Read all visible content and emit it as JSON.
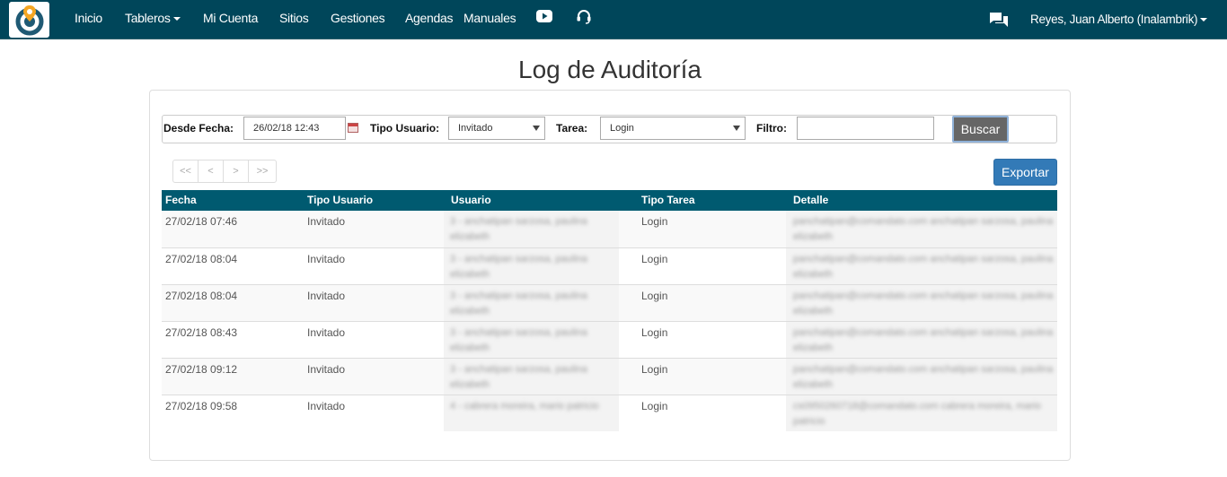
{
  "nav": {
    "items": [
      "Inicio",
      "Tableros",
      "Mi Cuenta",
      "Sitios",
      "Gestiones",
      "Agendas",
      "Manuales"
    ],
    "user": "Reyes, Juan Alberto (Inalambrik)",
    "colors": {
      "bar": "#00465a",
      "text": "#ffffff"
    },
    "icons": [
      "logo-icon",
      "youtube-icon",
      "headset-icon",
      "chat-icon"
    ]
  },
  "title": "Log de Auditoría",
  "filters": {
    "desde_label": "Desde Fecha:",
    "desde_value": "26/02/18 12:43",
    "tipo_label": "Tipo Usuario:",
    "tipo_value": "Invitado",
    "tarea_label": "Tarea:",
    "tarea_value": "Login",
    "filtro_label": "Filtro:",
    "filtro_value": "",
    "buscar": "Buscar"
  },
  "pager": [
    "<<",
    "<",
    ">",
    ">>"
  ],
  "export": "Exportar",
  "table": {
    "headers": [
      "Fecha",
      "Tipo Usuario",
      "Usuario",
      "Tipo Tarea",
      "Detalle"
    ],
    "header_color": "#005a70",
    "rows": [
      [
        "27/02/18 07:46",
        "Invitado",
        "3 - anchatipan sarzosa, paulina elizabeth",
        "Login",
        "panchatipan@comandato.com anchatipan sarzosa, paulina elizabeth"
      ],
      [
        "27/02/18 08:04",
        "Invitado",
        "3 - anchatipan sarzosa, paulina elizabeth",
        "Login",
        "panchatipan@comandato.com anchatipan sarzosa, paulina elizabeth"
      ],
      [
        "27/02/18 08:04",
        "Invitado",
        "3 - anchatipan sarzosa, paulina elizabeth",
        "Login",
        "panchatipan@comandato.com anchatipan sarzosa, paulina elizabeth"
      ],
      [
        "27/02/18 08:43",
        "Invitado",
        "3 - anchatipan sarzosa, paulina elizabeth",
        "Login",
        "panchatipan@comandato.com anchatipan sarzosa, paulina elizabeth"
      ],
      [
        "27/02/18 09:12",
        "Invitado",
        "3 - anchatipan sarzosa, paulina elizabeth",
        "Login",
        "panchatipan@comandato.com anchatipan sarzosa, paulina elizabeth"
      ],
      [
        "27/02/18 09:58",
        "Invitado",
        "4 - cabrera moreira, mario patricio",
        "Login",
        "cs0950260718@comandato.com cabrera moreira, mario patricio"
      ]
    ]
  }
}
